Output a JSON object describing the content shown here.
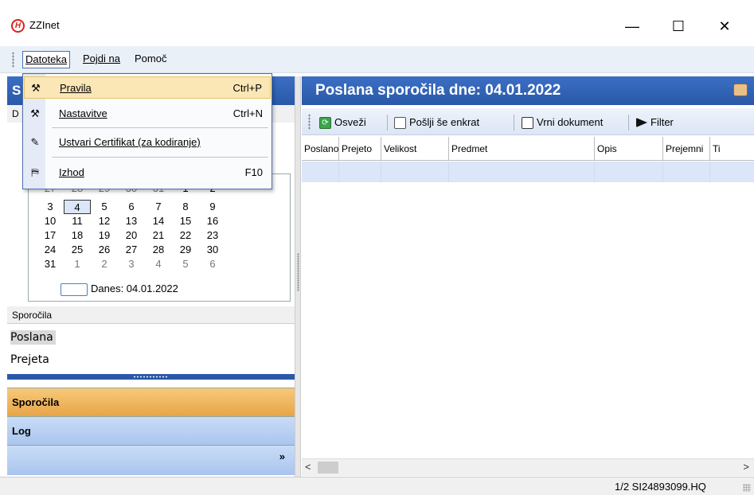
{
  "window": {
    "title": "ZZInet",
    "logo_text": "H",
    "min": "—",
    "max": "☐",
    "close": "✕"
  },
  "menubar": {
    "items": [
      "Datoteka",
      "Pojdi na",
      "Pomoč"
    ]
  },
  "dropdown": {
    "items": [
      {
        "label": "Pravila",
        "shortcut": "Ctrl+P",
        "icon": "tools-icon",
        "highlighted": true
      },
      {
        "label": "Nastavitve",
        "shortcut": "Ctrl+N",
        "icon": "settings-icon"
      },
      {
        "label": "Ustvari Certifikat (za kodiranje)",
        "shortcut": "",
        "icon": "wand-icon"
      },
      {
        "label": "Izhod",
        "shortcut": "F10",
        "icon": "exit-door-icon"
      }
    ]
  },
  "left": {
    "header": "S",
    "sub": "D",
    "calendar": {
      "cut_row": [
        "27",
        "28",
        "29",
        "30",
        "31",
        "1",
        "2"
      ],
      "rows": [
        [
          "3",
          "4",
          "5",
          "6",
          "7",
          "8",
          "9"
        ],
        [
          "10",
          "11",
          "12",
          "13",
          "14",
          "15",
          "16"
        ],
        [
          "17",
          "18",
          "19",
          "20",
          "21",
          "22",
          "23"
        ],
        [
          "24",
          "25",
          "26",
          "27",
          "28",
          "29",
          "30"
        ],
        [
          "31",
          "1",
          "2",
          "3",
          "4",
          "5",
          "6"
        ]
      ],
      "today": "Danes: 04.01.2022"
    },
    "section_label": "Sporočila",
    "list": [
      "Poslana",
      "Prejeta"
    ],
    "nav": [
      "Sporočila",
      "Log"
    ],
    "more": "»"
  },
  "right": {
    "header": "Poslana sporočila dne: 04.01.2022",
    "toolbar": [
      "Osveži",
      "Pošlji še enkrat",
      "Vrni dokument",
      "Filter"
    ],
    "columns": [
      "Poslano",
      "Prejeto",
      "Velikost",
      "Predmet",
      "Opis",
      "Prejemni",
      "Ti"
    ]
  },
  "status": {
    "text": "1/2  SI24893099.HQ"
  },
  "colors": {
    "header_blue": "#2a58a8",
    "nav_orange": "#e8a547",
    "menu_highlight": "#fbe7b5"
  }
}
